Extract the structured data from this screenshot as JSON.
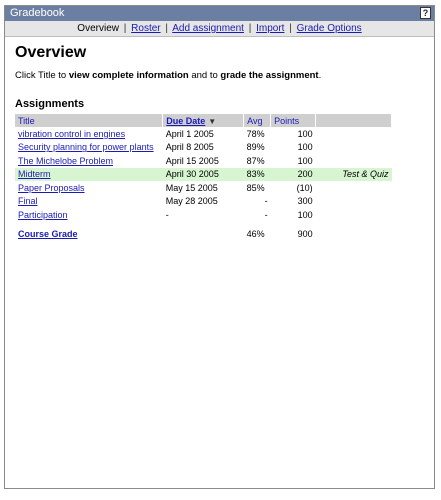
{
  "app": {
    "title": "Gradebook",
    "help_icon": "?"
  },
  "nav": {
    "current": "Overview",
    "links": {
      "roster": "Roster",
      "add_assignment": "Add assignment",
      "import": "Import",
      "grade_options": "Grade Options"
    },
    "sep": "|"
  },
  "page": {
    "title": "Overview",
    "intro": {
      "pre": "Click Title to ",
      "b1": "view complete information",
      "mid": " and to ",
      "b2": "grade the assignment",
      "post": "."
    },
    "section_title": "Assignments"
  },
  "table": {
    "headers": {
      "title": "Title",
      "due": "Due Date",
      "avg": "Avg",
      "points": "Points",
      "extra": ""
    },
    "rows": [
      {
        "title": "vibration control in engines",
        "due": "April 1 2005",
        "avg": "78%",
        "points": "100",
        "tag": ""
      },
      {
        "title": "Security planning for power plants",
        "due": "April 8 2005",
        "avg": "89%",
        "points": "100",
        "tag": ""
      },
      {
        "title": "The Michelobe Problem",
        "due": "April 15 2005",
        "avg": "87%",
        "points": "100",
        "tag": ""
      },
      {
        "title": "Midterm",
        "due": "April 30 2005",
        "avg": "83%",
        "points": "200",
        "tag": "Test & Quiz"
      },
      {
        "title": "Paper Proposals",
        "due": "May 15 2005",
        "avg": "85%",
        "points": "(10)",
        "tag": ""
      },
      {
        "title": "Final",
        "due": "May 28 2005",
        "avg": "-",
        "points": "300",
        "tag": ""
      },
      {
        "title": "Participation",
        "due": "-",
        "avg": "-",
        "points": "100",
        "tag": ""
      }
    ],
    "course": {
      "title": "Course Grade",
      "avg": "46%",
      "points": "900"
    }
  },
  "colors": {
    "titlebar": "#6b7fa3",
    "link": "#1a1ab5",
    "highlight": "#d6f5d0",
    "header_bg": "#cfcfcf"
  }
}
